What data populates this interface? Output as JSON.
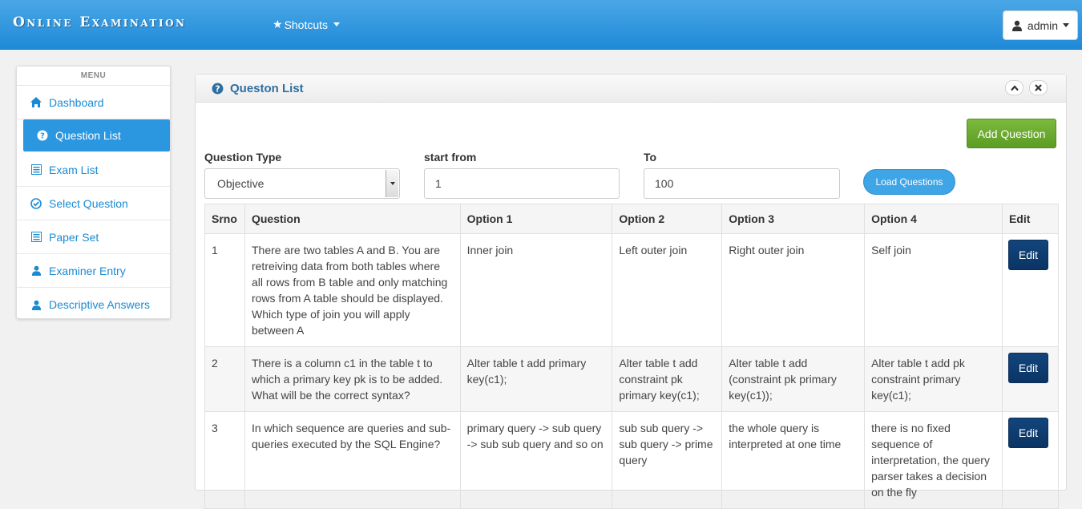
{
  "navbar": {
    "brand": "Online Examination",
    "shortcuts_label": "Shotcuts",
    "user_label": "admin"
  },
  "sidebar": {
    "header": "MENU",
    "items": [
      {
        "label": "Dashboard",
        "icon": "home-icon"
      },
      {
        "label": "Question List",
        "icon": "question-circle-icon",
        "active": true
      },
      {
        "label": "Exam List",
        "icon": "list-icon"
      },
      {
        "label": "Select Question",
        "icon": "check-circle-icon"
      },
      {
        "label": "Paper Set",
        "icon": "list-icon"
      },
      {
        "label": "Examiner Entry",
        "icon": "user-icon"
      },
      {
        "label": "Descriptive Answers",
        "icon": "user-icon"
      }
    ]
  },
  "panel": {
    "title": "Queston List",
    "add_button": "Add Question",
    "filters": {
      "question_type_label": "Question Type",
      "question_type_value": "Objective",
      "start_label": "start from",
      "start_value": "1",
      "to_label": "To",
      "to_value": "100",
      "load_button": "Load Questions"
    },
    "table": {
      "headers": [
        "Srno",
        "Question",
        "Option 1",
        "Option 2",
        "Option 3",
        "Option 4",
        "Edit"
      ],
      "edit_label": "Edit",
      "rows": [
        {
          "srno": "1",
          "question": "There are two tables A and B. You are retreiving data from both tables where all rows from B table and only matching rows from A table should be displayed. Which type of join you will apply between A",
          "opt1": "Inner join",
          "opt2": "Left outer join",
          "opt3": "Right outer join",
          "opt4": "Self join"
        },
        {
          "srno": "2",
          "question": "There is a column c1 in the table t to which a primary key pk is to be added. What will be the correct syntax?",
          "opt1": "Alter table t add primary key(c1);",
          "opt2": "Alter table t add constraint pk primary key(c1);",
          "opt3": "Alter table t add (constraint pk primary key(c1));",
          "opt4": "Alter table t add pk constraint primary key(c1);"
        },
        {
          "srno": "3",
          "question": "In which sequence are queries and sub-queries executed by the SQL Engine?",
          "opt1": "primary query -> sub query -> sub sub query and so on",
          "opt2": "sub sub query -> sub query -> prime query",
          "opt3": "the whole query is interpreted at one time",
          "opt4": "there is no fixed sequence of interpretation, the query parser takes a decision on the fly"
        }
      ]
    }
  },
  "colors": {
    "navbar": "#2a93dd",
    "accent": "#2b97e0",
    "add_button": "#6aab2f",
    "edit_button": "#0f3d70"
  }
}
